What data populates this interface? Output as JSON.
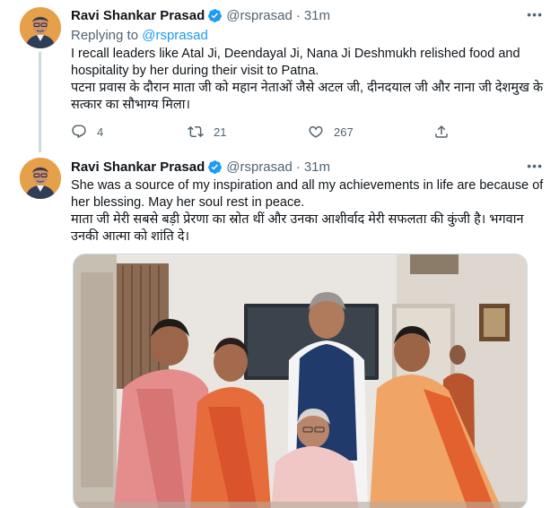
{
  "tweets": [
    {
      "author_name": "Ravi Shankar Prasad",
      "handle": "@rsprasad",
      "separator": "·",
      "time": "31m",
      "more_icon": "more-dots-icon",
      "reply_prefix": "Replying to",
      "reply_to": "@rsprasad",
      "text_lines": [
        "I recall leaders like Atal Ji, Deendayal Ji, Nana Ji Deshmukh relished food and hospitality by her during their visit to Patna.",
        "पटना प्रवास के दौरान माता जी को महान नेताओं जैसे अटल जी, दीनदयाल जी और नाना जी देशमुख के सत्कार का सौभाग्य मिला।"
      ],
      "actions": {
        "reply_count": "4",
        "retweet_count": "21",
        "like_count": "267"
      }
    },
    {
      "author_name": "Ravi Shankar Prasad",
      "handle": "@rsprasad",
      "separator": "·",
      "time": "31m",
      "more_icon": "more-dots-icon",
      "text_lines": [
        "She was a source of my inspiration and all my achievements in life are because of her blessing. May her soul rest in peace.",
        "माता जी मेरी सबसे बड़ी प्रेरणा का स्रोत थीं और उनका आशीर्वाद मेरी सफलता की कुंजी है। भगवान उनकी आत्मा को शांति दे।"
      ]
    }
  ],
  "colors": {
    "link": "#1d9bf0",
    "verified": "#1d9bf0",
    "secondary_text": "#536471",
    "thread_line": "#cfd9de"
  }
}
